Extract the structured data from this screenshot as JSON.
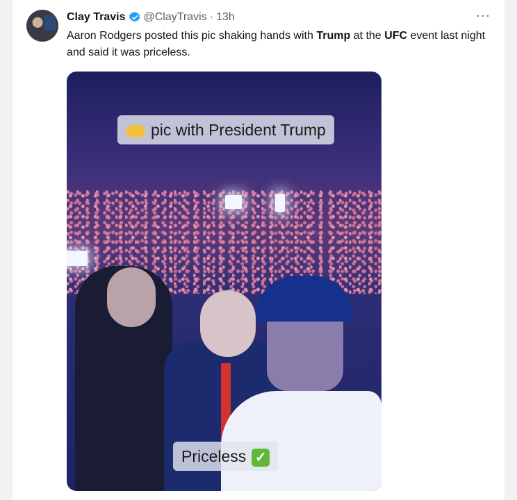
{
  "tweet": {
    "author_name": "Clay Travis",
    "handle": "@ClayTravis",
    "separator": "·",
    "time": "13h",
    "more_label": "···",
    "text_parts": [
      {
        "text": "Aaron Rodgers posted this pic shaking hands with ",
        "bold": false
      },
      {
        "text": "Trump",
        "bold": true
      },
      {
        "text": " at the ",
        "bold": false
      },
      {
        "text": "UFC",
        "bold": true
      },
      {
        "text": " event last night and said it was priceless.",
        "bold": false
      }
    ]
  },
  "media": {
    "caption_top": "pic with President Trump",
    "caption_bottom": "Priceless",
    "caption_top_emoji": "handshake-emoji",
    "caption_bottom_emoji": "check-mark-emoji"
  },
  "colors": {
    "verified": "#1d9bf0",
    "muted": "#536471",
    "text": "#0f1419"
  }
}
